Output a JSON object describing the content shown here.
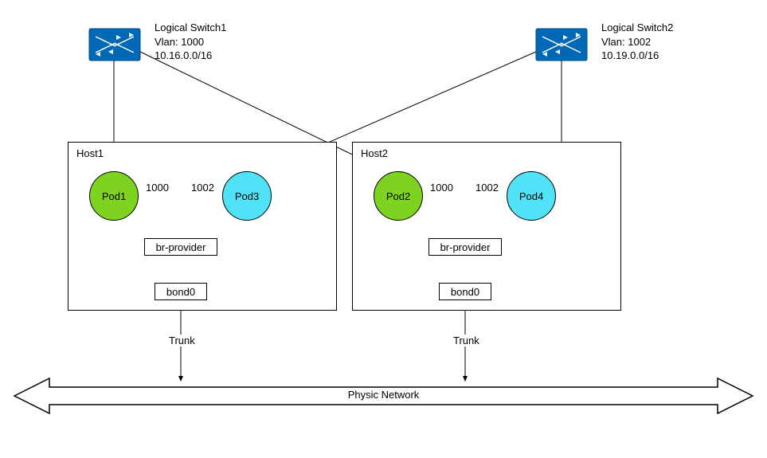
{
  "switches": [
    {
      "name": "Logical Switch1",
      "vlan": "Vlan: 1000",
      "subnet": "10.16.0.0/16"
    },
    {
      "name": "Logical Switch2",
      "vlan": "Vlan: 1002",
      "subnet": "10.19.0.0/16"
    }
  ],
  "hosts": [
    {
      "label": "Host1",
      "pods": [
        {
          "id": "Pod1"
        },
        {
          "id": "Pod3"
        }
      ],
      "vlan_left": "1000",
      "vlan_right": "1002",
      "bridge": "br-provider",
      "bond": "bond0",
      "trunk": "Trunk"
    },
    {
      "label": "Host2",
      "pods": [
        {
          "id": "Pod2"
        },
        {
          "id": "Pod4"
        }
      ],
      "vlan_left": "1000",
      "vlan_right": "1002",
      "bridge": "br-provider",
      "bond": "bond0",
      "trunk": "Trunk"
    }
  ],
  "physic_network": "Physic Network"
}
